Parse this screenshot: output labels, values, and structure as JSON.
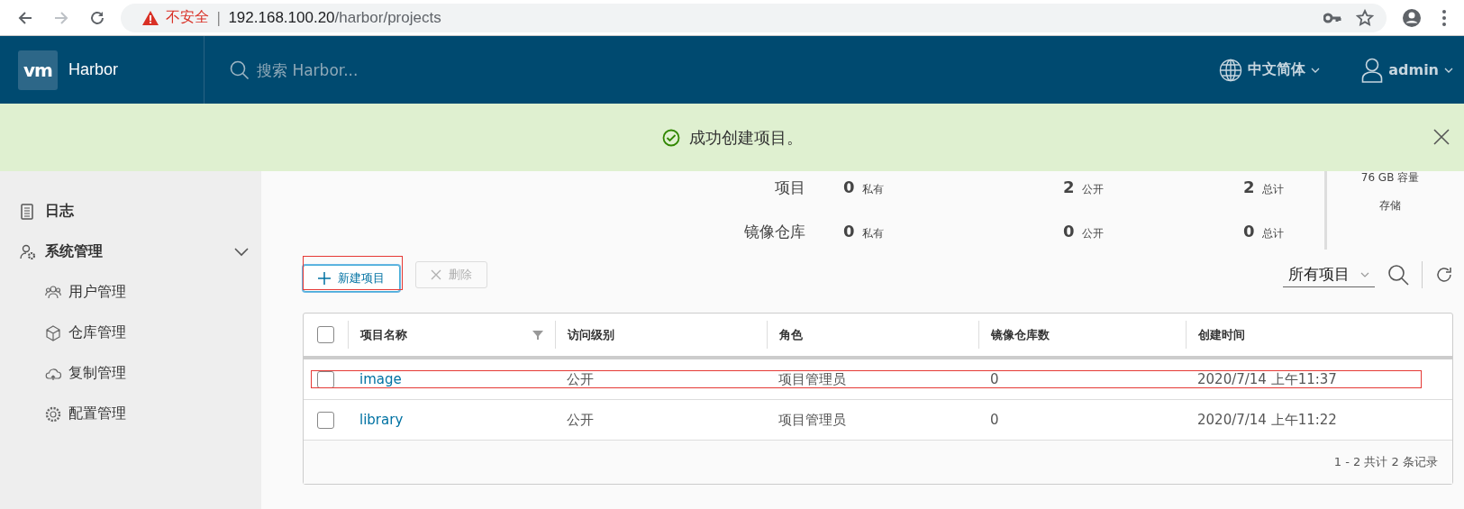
{
  "browser": {
    "security_label": "不安全",
    "separator": "|",
    "url_host": "192.168.100.20",
    "url_path": "/harbor/projects",
    "forward_disabled": true
  },
  "header": {
    "logo": "vm",
    "brand": "Harbor",
    "search_placeholder": "搜索 Harbor...",
    "language": "中文简体",
    "user": "admin"
  },
  "notification": {
    "kind": "success",
    "message": "成功创建项目。"
  },
  "sidebar": {
    "items": [
      {
        "label": "日志"
      },
      {
        "label": "系统管理",
        "expanded": true,
        "children": [
          {
            "label": "用户管理"
          },
          {
            "label": "仓库管理"
          },
          {
            "label": "复制管理"
          },
          {
            "label": "配置管理"
          }
        ]
      }
    ]
  },
  "stats": {
    "rows": [
      {
        "label": "项目",
        "cells": [
          {
            "value": "0",
            "unit": "私有"
          },
          {
            "value": "2",
            "unit": "公开"
          },
          {
            "value": "2",
            "unit": "总计"
          }
        ]
      },
      {
        "label": "镜像仓库",
        "cells": [
          {
            "value": "0",
            "unit": "私有"
          },
          {
            "value": "0",
            "unit": "公开"
          },
          {
            "value": "0",
            "unit": "总计"
          }
        ]
      }
    ],
    "storage": {
      "capacity": "76 GB 容量",
      "label": "存储"
    }
  },
  "toolbar": {
    "new_button": {
      "label": "新建项目",
      "annotated": true
    },
    "delete_button": {
      "label": "删除",
      "disabled": true
    },
    "filter": "所有项目"
  },
  "table": {
    "all_checked": false,
    "columns": [
      {
        "label": "项目名称",
        "filterable": true
      },
      {
        "label": "访问级别",
        "filterable": false
      },
      {
        "label": "角色",
        "filterable": false
      },
      {
        "label": "镜像仓库数",
        "filterable": false
      },
      {
        "label": "创建时间",
        "filterable": false
      }
    ],
    "rows": [
      {
        "checked": false,
        "annotated": true,
        "cells": [
          "image",
          "公开",
          "项目管理员",
          "0",
          "2020/7/14 上午11:37"
        ]
      },
      {
        "checked": false,
        "annotated": false,
        "cells": [
          "library",
          "公开",
          "项目管理员",
          "0",
          "2020/7/14 上午11:22"
        ]
      }
    ],
    "footer": "1 - 2 共计 2 条记录"
  }
}
